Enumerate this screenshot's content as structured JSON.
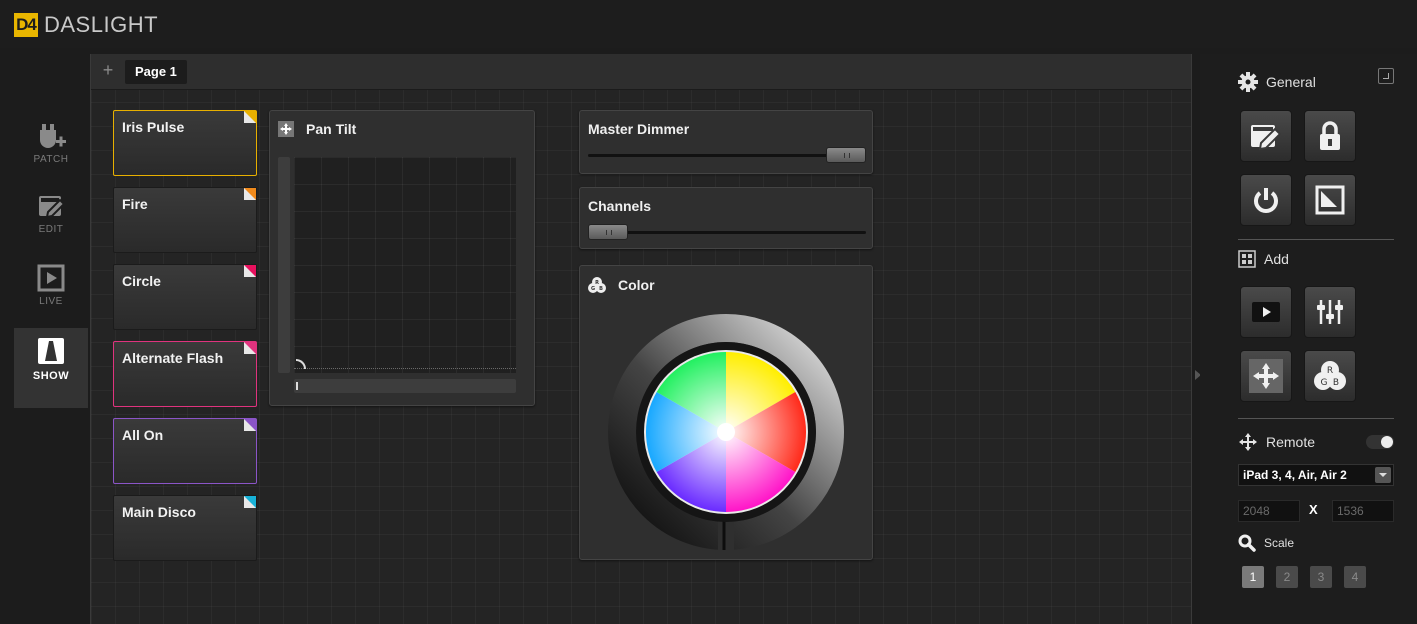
{
  "app": {
    "logo_mark": "D4",
    "name": "DASLIGHT"
  },
  "nav": {
    "patch": "PATCH",
    "edit": "EDIT",
    "live": "LIVE",
    "show": "SHOW"
  },
  "page_tabs": {
    "add": "+",
    "active": "Page 1"
  },
  "scenes": [
    {
      "name": "Iris Pulse",
      "color": "#e8b000"
    },
    {
      "name": "Fire",
      "color": "#f08a1c"
    },
    {
      "name": "Circle",
      "color": "#e8115e"
    },
    {
      "name": "Alternate Flash",
      "color": "#e0337e"
    },
    {
      "name": "All On",
      "color": "#8b55c8"
    },
    {
      "name": "Main Disco",
      "color": "#18b2d8"
    }
  ],
  "panels": {
    "pan_tilt": {
      "title": "Pan Tilt"
    },
    "master_dimmer": {
      "title": "Master Dimmer",
      "level": 1.0
    },
    "channels": {
      "title": "Channels",
      "level": 0.0
    },
    "color": {
      "title": "Color"
    }
  },
  "sidebar": {
    "general": "General",
    "add": "Add",
    "remote": "Remote",
    "device": "iPad 3, 4, Air, Air 2",
    "width": "2048",
    "times": "X",
    "height": "1536",
    "scale": "Scale",
    "scale_options": [
      "1",
      "2",
      "3",
      "4"
    ],
    "scale_selected": "1"
  }
}
